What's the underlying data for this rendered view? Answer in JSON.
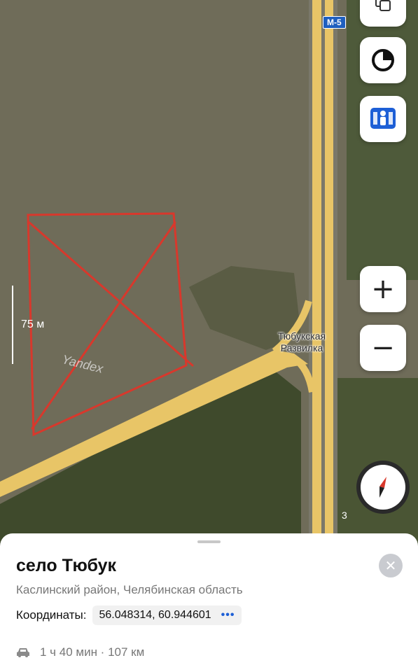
{
  "map": {
    "road_sign": "M-5",
    "place_label_line1": "Тюбукская",
    "place_label_line2": "Развилка",
    "scale_label": "75 м",
    "watermark": "Yandex",
    "house_number": "3",
    "buttons": {
      "layers_icon": "layers-icon",
      "location_icon": "location-icon",
      "panorama_icon": "panorama-icon",
      "zoom_in": "+",
      "zoom_out": "−",
      "compass_icon": "compass-icon"
    },
    "colors": {
      "road": "#e8c567",
      "annotation": "#d8382c",
      "accent_blue": "#1d5fd6"
    }
  },
  "sheet": {
    "title": "село Тюбук",
    "subtitle": "Каслинский район, Челябинская область",
    "coords_label": "Координаты:",
    "coords_value": "56.048314, 60.944601",
    "coords_more": "•••",
    "route_text": "1 ч 40 мин · 107 км",
    "close_icon": "close-icon",
    "car_icon": "car-icon"
  }
}
